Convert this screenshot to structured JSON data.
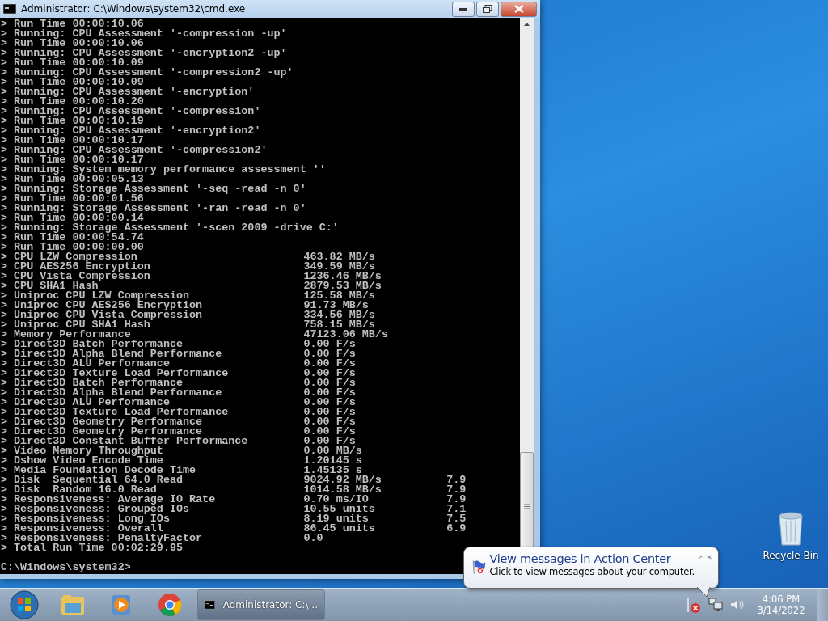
{
  "window": {
    "title": "Administrator: C:\\Windows\\system32\\cmd.exe"
  },
  "console": {
    "lines": [
      {
        "kind": "log",
        "text": "> Run Time 00:00:10.06"
      },
      {
        "kind": "log",
        "text": "> Running: CPU Assessment '-compression -up'"
      },
      {
        "kind": "log",
        "text": "> Run Time 00:00:10.06"
      },
      {
        "kind": "log",
        "text": "> Running: CPU Assessment '-encryption2 -up'"
      },
      {
        "kind": "log",
        "text": "> Run Time 00:00:10.09"
      },
      {
        "kind": "log",
        "text": "> Running: CPU Assessment '-compression2 -up'"
      },
      {
        "kind": "log",
        "text": "> Run Time 00:00:10.09"
      },
      {
        "kind": "log",
        "text": "> Running: CPU Assessment '-encryption'"
      },
      {
        "kind": "log",
        "text": "> Run Time 00:00:10.20"
      },
      {
        "kind": "log",
        "text": "> Running: CPU Assessment '-compression'"
      },
      {
        "kind": "log",
        "text": "> Run Time 00:00:10.19"
      },
      {
        "kind": "log",
        "text": "> Running: CPU Assessment '-encryption2'"
      },
      {
        "kind": "log",
        "text": "> Run Time 00:00:10.17"
      },
      {
        "kind": "log",
        "text": "> Running: CPU Assessment '-compression2'"
      },
      {
        "kind": "log",
        "text": "> Run Time 00:00:10.17"
      },
      {
        "kind": "log",
        "text": "> Running: System memory performance assessment ''"
      },
      {
        "kind": "log",
        "text": "> Run Time 00:00:05.13"
      },
      {
        "kind": "log",
        "text": "> Running: Storage Assessment '-seq -read -n 0'"
      },
      {
        "kind": "log",
        "text": "> Run Time 00:00:01.56"
      },
      {
        "kind": "log",
        "text": "> Running: Storage Assessment '-ran -read -n 0'"
      },
      {
        "kind": "log",
        "text": "> Run Time 00:00:00.14"
      },
      {
        "kind": "log",
        "text": "> Running: Storage Assessment '-scen 2009 -drive C:'"
      },
      {
        "kind": "log",
        "text": "> Run Time 00:00:54.74"
      },
      {
        "kind": "log",
        "text": "> Run Time 00:00:00.00"
      },
      {
        "kind": "result",
        "label": "> CPU LZW Compression",
        "value": "463.82 MB/s"
      },
      {
        "kind": "result",
        "label": "> CPU AES256 Encryption",
        "value": "349.59 MB/s"
      },
      {
        "kind": "result",
        "label": "> CPU Vista Compression",
        "value": "1236.46 MB/s"
      },
      {
        "kind": "result",
        "label": "> CPU SHA1 Hash",
        "value": "2879.53 MB/s"
      },
      {
        "kind": "result",
        "label": "> Uniproc CPU LZW Compression",
        "value": "125.58 MB/s"
      },
      {
        "kind": "result",
        "label": "> Uniproc CPU AES256 Encryption",
        "value": "91.73 MB/s"
      },
      {
        "kind": "result",
        "label": "> Uniproc CPU Vista Compression",
        "value": "334.56 MB/s"
      },
      {
        "kind": "result",
        "label": "> Uniproc CPU SHA1 Hash",
        "value": "758.15 MB/s"
      },
      {
        "kind": "result",
        "label": "> Memory Performance",
        "value": "47123.06 MB/s"
      },
      {
        "kind": "result",
        "label": "> Direct3D Batch Performance",
        "value": "0.00 F/s"
      },
      {
        "kind": "result",
        "label": "> Direct3D Alpha Blend Performance",
        "value": "0.00 F/s"
      },
      {
        "kind": "result",
        "label": "> Direct3D ALU Performance",
        "value": "0.00 F/s"
      },
      {
        "kind": "result",
        "label": "> Direct3D Texture Load Performance",
        "value": "0.00 F/s"
      },
      {
        "kind": "result",
        "label": "> Direct3D Batch Performance",
        "value": "0.00 F/s"
      },
      {
        "kind": "result",
        "label": "> Direct3D Alpha Blend Performance",
        "value": "0.00 F/s"
      },
      {
        "kind": "result",
        "label": "> Direct3D ALU Performance",
        "value": "0.00 F/s"
      },
      {
        "kind": "result",
        "label": "> Direct3D Texture Load Performance",
        "value": "0.00 F/s"
      },
      {
        "kind": "result",
        "label": "> Direct3D Geometry Performance",
        "value": "0.00 F/s"
      },
      {
        "kind": "result",
        "label": "> Direct3D Geometry Performance",
        "value": "0.00 F/s"
      },
      {
        "kind": "result",
        "label": "> Direct3D Constant Buffer Performance",
        "value": "0.00 F/s"
      },
      {
        "kind": "result",
        "label": "> Video Memory Throughput",
        "value": "0.00 MB/s"
      },
      {
        "kind": "result",
        "label": "> Dshow Video Encode Time",
        "value": "1.20145 s"
      },
      {
        "kind": "result",
        "label": "> Media Foundation Decode Time",
        "value": "1.45135 s"
      },
      {
        "kind": "result",
        "label": "> Disk  Sequential 64.0 Read",
        "value": "9024.92 MB/s",
        "score": "7.9"
      },
      {
        "kind": "result",
        "label": "> Disk  Random 16.0 Read",
        "value": "1014.58 MB/s",
        "score": "7.9"
      },
      {
        "kind": "result",
        "label": "> Responsiveness: Average IO Rate",
        "value": "0.70 ms/IO",
        "score": "7.9"
      },
      {
        "kind": "result",
        "label": "> Responsiveness: Grouped IOs",
        "value": "10.55 units",
        "score": "7.1"
      },
      {
        "kind": "result",
        "label": "> Responsiveness: Long IOs",
        "value": "8.19 units",
        "score": "7.5"
      },
      {
        "kind": "result",
        "label": "> Responsiveness: Overall",
        "value": "86.45 units",
        "score": "6.9"
      },
      {
        "kind": "result",
        "label": "> Responsiveness: PenaltyFactor",
        "value": "0.0"
      },
      {
        "kind": "log",
        "text": "> Total Run Time 00:02:29.95"
      }
    ],
    "prompt": "C:\\Windows\\system32>"
  },
  "desktop_icons": [
    {
      "label": "Recycle Bin"
    }
  ],
  "balloon": {
    "title": "View messages in Action Center",
    "text": "Click to view messages about your computer."
  },
  "taskbar": {
    "pinned": [
      {
        "kind": "explorer"
      },
      {
        "kind": "media"
      },
      {
        "kind": "browser"
      }
    ],
    "tasks": [
      {
        "label": "Administrator: C:\\...",
        "selected": true
      }
    ],
    "clock": {
      "time": "4:06 PM",
      "date": "3/14/2022"
    }
  }
}
